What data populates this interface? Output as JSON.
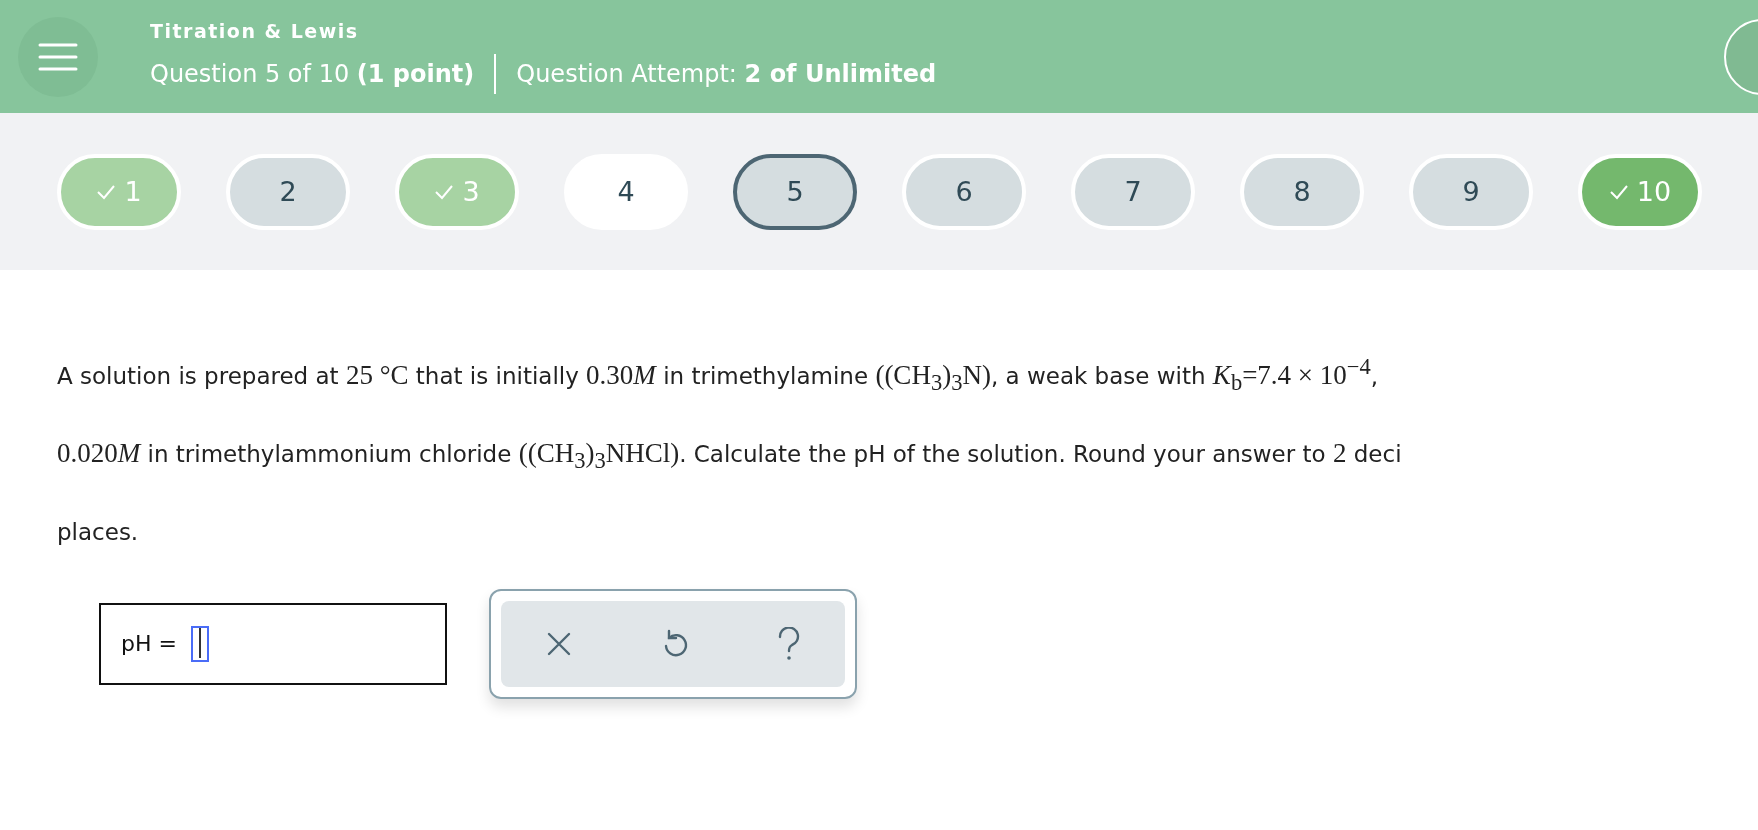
{
  "header": {
    "topic": "Titration & Lewis",
    "question": "Question 5 of 10",
    "points": "(1 point)",
    "attempt_label": "Question Attempt:",
    "attempt_value": "2 of Unlimited"
  },
  "question_nav": [
    {
      "label": "1",
      "checked": true,
      "selected": false,
      "color": "#a7d3a3"
    },
    {
      "label": "2",
      "checked": false,
      "selected": false,
      "color": "#d5dde0"
    },
    {
      "label": "3",
      "checked": true,
      "selected": false,
      "color": "#a7d3a3"
    },
    {
      "label": "4",
      "checked": false,
      "selected": false,
      "color": "#ffffff"
    },
    {
      "label": "5",
      "checked": false,
      "selected": true,
      "color": "#d5dde0"
    },
    {
      "label": "6",
      "checked": false,
      "selected": false,
      "color": "#d5dde0"
    },
    {
      "label": "7",
      "checked": false,
      "selected": false,
      "color": "#d5dde0"
    },
    {
      "label": "8",
      "checked": false,
      "selected": false,
      "color": "#d5dde0"
    },
    {
      "label": "9",
      "checked": false,
      "selected": false,
      "color": "#d5dde0"
    },
    {
      "label": "10",
      "checked": true,
      "selected": false,
      "color": "#74b86d"
    }
  ],
  "question_lines": [
    [
      {
        "kind": "text",
        "text": "A solution is prepared at "
      },
      {
        "kind": "math",
        "text": "25 °C"
      },
      {
        "kind": "text",
        "text": " that is initially "
      },
      {
        "kind": "math",
        "text": "0.30"
      },
      {
        "kind": "var",
        "text": "M"
      },
      {
        "kind": "text",
        "text": " in trimethylamine "
      },
      {
        "kind": "math",
        "text": "((CH$_{3}$)$_{3}$N)"
      },
      {
        "kind": "text",
        "text": ", a weak base with "
      },
      {
        "kind": "math",
        "text": "*K*$_{b}$=7.4 × 10$^{−4}$"
      },
      {
        "kind": "text",
        "text": ","
      }
    ],
    [
      {
        "kind": "math",
        "text": "0.020"
      },
      {
        "kind": "var",
        "text": "M"
      },
      {
        "kind": "text",
        "text": " in trimethylammonium chloride "
      },
      {
        "kind": "math",
        "text": "((CH$_{3}$)$_{3}$NHCl)"
      },
      {
        "kind": "text",
        "text": ". Calculate the pH of the solution. Round your answer to "
      },
      {
        "kind": "math",
        "text": "2"
      },
      {
        "kind": "text",
        "text": " deci"
      }
    ],
    [
      {
        "kind": "text",
        "text": "places."
      }
    ]
  ],
  "answer": {
    "label": "pH ="
  },
  "tools": [
    {
      "kind": "clear"
    },
    {
      "kind": "undo"
    },
    {
      "kind": "help"
    }
  ]
}
